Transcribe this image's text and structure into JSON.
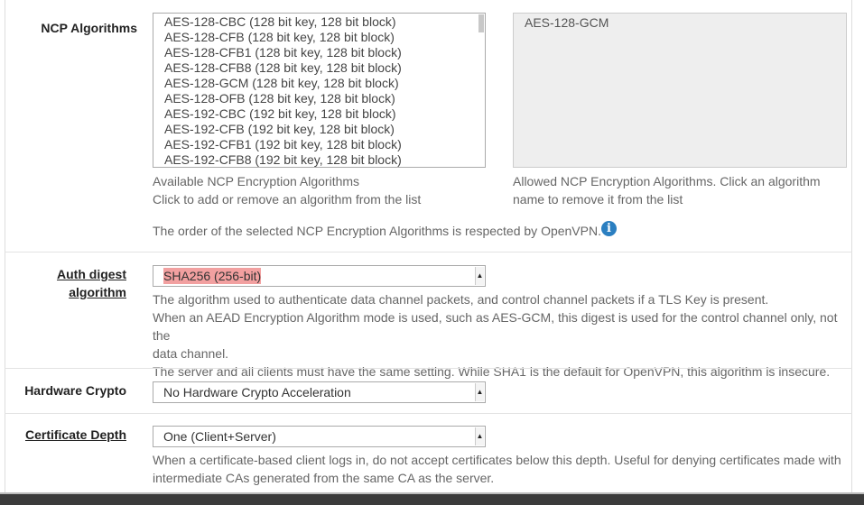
{
  "ncp": {
    "label": "NCP Algorithms",
    "available_options": [
      "AES-128-CBC (128 bit key, 128 bit block)",
      "AES-128-CFB (128 bit key, 128 bit block)",
      "AES-128-CFB1 (128 bit key, 128 bit block)",
      "AES-128-CFB8 (128 bit key, 128 bit block)",
      "AES-128-GCM (128 bit key, 128 bit block)",
      "AES-128-OFB (128 bit key, 128 bit block)",
      "AES-192-CBC (192 bit key, 128 bit block)",
      "AES-192-CFB (192 bit key, 128 bit block)",
      "AES-192-CFB1 (192 bit key, 128 bit block)",
      "AES-192-CFB8 (192 bit key, 128 bit block)"
    ],
    "allowed_options": [
      "AES-128-GCM"
    ],
    "available_help_line1": "Available NCP Encryption Algorithms",
    "available_help_line2": "Click to add or remove an algorithm from the list",
    "allowed_help_line1": "Allowed NCP Encryption Algorithms. Click an algorithm",
    "allowed_help_line2": "name to remove it from the list",
    "order_note": "The order of the selected NCP Encryption Algorithms is respected by OpenVPN."
  },
  "auth_digest": {
    "label_line1": "Auth digest",
    "label_line2": "algorithm",
    "value": "SHA256 (256-bit)",
    "help_line1": "The algorithm used to authenticate data channel packets, and control channel packets if a TLS Key is present.",
    "help_line2": "When an AEAD Encryption Algorithm mode is used, such as AES-GCM, this digest is used for the control channel only, not the",
    "help_line3": "data channel.",
    "help_line4": "The server and all clients must have the same setting. While SHA1 is the default for OpenVPN, this algorithm is insecure."
  },
  "hardware_crypto": {
    "label": "Hardware Crypto",
    "value": "No Hardware Crypto Acceleration"
  },
  "cert_depth": {
    "label": "Certificate Depth",
    "value": "One (Client+Server)",
    "help_line1": "When a certificate-based client logs in, do not accept certificates below this depth. Useful for denying certificates made with",
    "help_line2": "intermediate CAs generated from the same CA as the server."
  },
  "icons": {
    "info": "info-circle-icon",
    "caret": "select-caret-icon"
  },
  "colors": {
    "warning_highlight": "#f2a0a0",
    "info_blue": "#2b7fc1"
  }
}
